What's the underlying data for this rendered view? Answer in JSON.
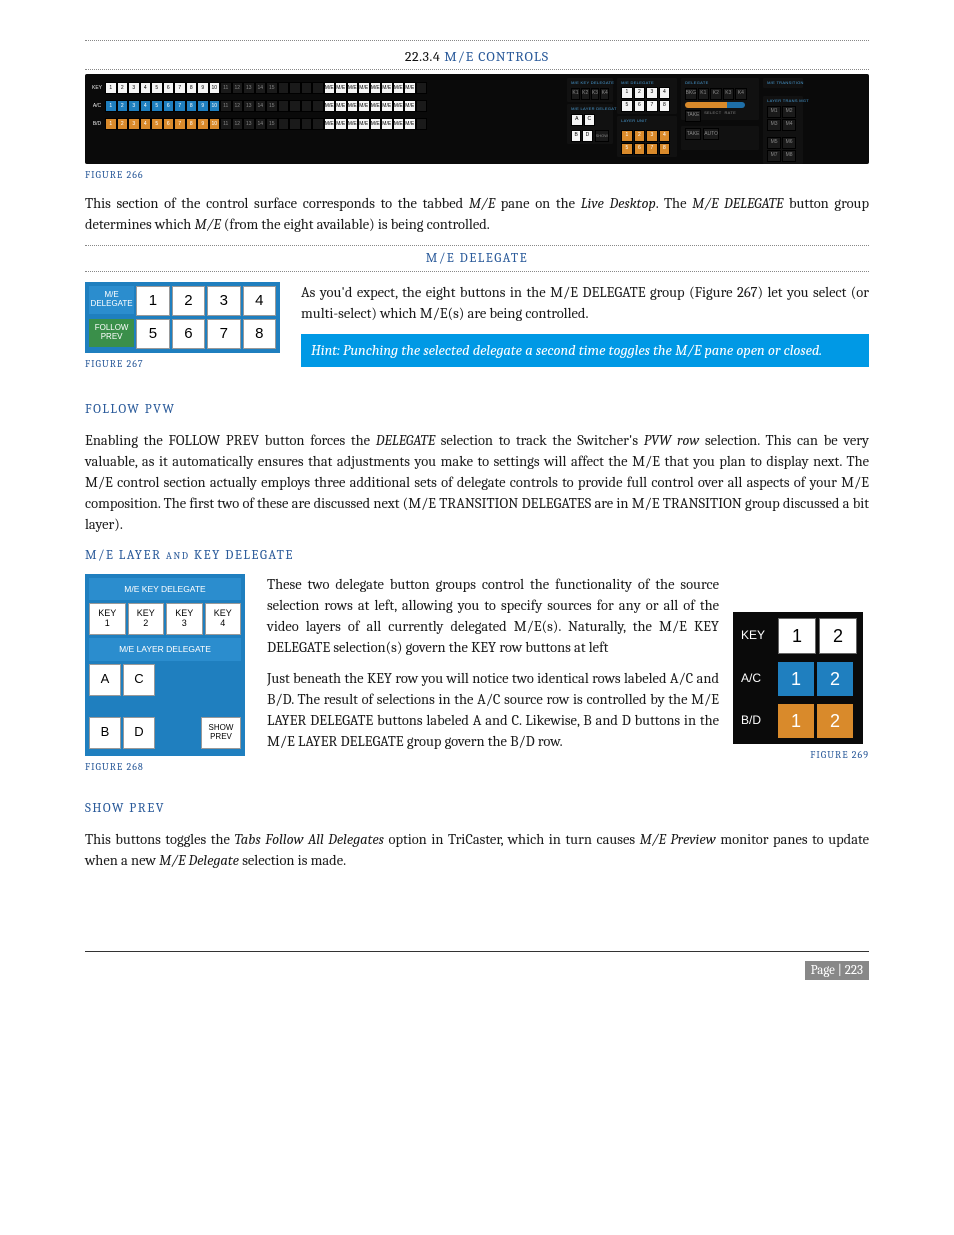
{
  "section": {
    "number": "22.3.4",
    "title": "M/E CONTROLS"
  },
  "captions": {
    "fig266": "FIGURE 266",
    "fig267": "FIGURE 267",
    "fig268": "FIGURE 268",
    "fig269": "FIGURE 269"
  },
  "para1": {
    "pre": "This section of the control surface corresponds to the tabbed ",
    "i1": "M/E",
    "mid1": " pane on the ",
    "i2": "Live Desktop",
    "mid2": ".  The ",
    "i3": "M/E DELEGATE",
    "post": " button group determines which ",
    "i4": "M/E",
    "tail": " (from the eight available) is being controlled."
  },
  "subheadings": {
    "me_delegate": "M/E DELEGATE",
    "follow_pvw": "FOLLOW PVW",
    "me_layer_key": "M/E LAYER AND KEY DELEGATE",
    "show_prev": "SHOW PREV"
  },
  "delegate_panel": {
    "label_top": "M/E DELEGATE",
    "label_bottom": "FOLLOW PREV",
    "buttons": [
      "1",
      "2",
      "3",
      "4",
      "5",
      "6",
      "7",
      "8"
    ]
  },
  "para2": "As you'd expect, the eight buttons in the M/E DELEGATE group (Figure 267) let you select (or multi-select) which M/E(s) are being controlled.",
  "hint": "Hint: Punching the selected delegate a second time toggles the M/E pane open or closed.",
  "follow_pvw_para": {
    "pre": "Enabling the FOLLOW PREV button forces the ",
    "i1": "DELEGATE",
    "mid1": " selection to track the Switcher's ",
    "i2": "PVW row",
    "post": " selection. This can be very valuable, as it automatically ensures that adjustments you make to settings will affect the M/E that you plan to display next.  The M/E control section actually employs three additional sets of delegate controls to provide full control over all aspects of your M/E composition. The first two of these are discussed next (M/E TRANSITION DELEGATES are in M/E TRANSITION group discussed a bit layer)."
  },
  "layer_para1": "These two delegate button groups control the functionality of the source selection rows at left, allowing you to specify sources for any or all of the video layers of all currently delegated M/E(s). Naturally, the M/E KEY DELEGATE selection(s) govern the KEY row buttons at left",
  "layer_para2": "Just beneath the KEY row you will notice two identical rows labeled A/C and B/D. The result of selections in the A/C source row is controlled by the M/E LAYER DELEGATE buttons labeled A and C.  Likewise, B and D buttons in the M/E LAYER DELEGATE group govern the B/D row.",
  "key_layer_panel": {
    "title_key": "M/E KEY DELEGATE",
    "keys": [
      "KEY 1",
      "KEY 2",
      "KEY 3",
      "KEY 4"
    ],
    "title_layer": "M/E LAYER DELEGATE",
    "ac": [
      "A",
      "C"
    ],
    "bd": [
      "B",
      "D"
    ],
    "show_prev": "SHOW PREV"
  },
  "key_rows_panel": {
    "rows": [
      {
        "label": "KEY",
        "btns": [
          "1",
          "2"
        ],
        "style": "white"
      },
      {
        "label": "A/C",
        "btns": [
          "1",
          "2"
        ],
        "style": "blue"
      },
      {
        "label": "B/D",
        "btns": [
          "1",
          "2"
        ],
        "style": "orange"
      }
    ]
  },
  "show_prev_para": {
    "pre": "This buttons toggles the ",
    "i1": "Tabs Follow All Delegates",
    "mid": " option in TriCaster, which in turn causes ",
    "i2": "M/E Preview",
    "post": " monitor panes to update when a new ",
    "i3": "M/E Delegate",
    "tail": " selection is made."
  },
  "large_panel": {
    "row_labels": [
      "KEY",
      "A/C",
      "B/D"
    ],
    "nums": [
      "1",
      "2",
      "3",
      "4",
      "5",
      "6",
      "7",
      "8",
      "9",
      "10",
      "11",
      "12",
      "13",
      "14",
      "15"
    ],
    "me_labels": [
      "M/E 1",
      "M/E 2",
      "M/E 3",
      "M/E 4",
      "M/E 5",
      "M/E 6",
      "M/E 7",
      "M/E 8"
    ],
    "right_headers": [
      "M/E KEY DELEGATE",
      "M/E DELEGATE",
      "DELEGATE",
      "M/E TRANSITION",
      "LAYER TRANS MGT",
      "M/E LAYER DELEGATE",
      "LAYER UNIT"
    ],
    "key_small": [
      "KEY 1",
      "KEY 2",
      "KEY 3",
      "KEY 4"
    ],
    "del_nums": [
      "1",
      "2",
      "3",
      "4",
      "5",
      "6",
      "7",
      "8"
    ],
    "layer_small": [
      "A",
      "C",
      "B",
      "D"
    ],
    "unit": [
      "1",
      "2",
      "3",
      "4",
      "5",
      "6",
      "7",
      "8"
    ]
  },
  "footer": {
    "page": "Page | 223"
  }
}
